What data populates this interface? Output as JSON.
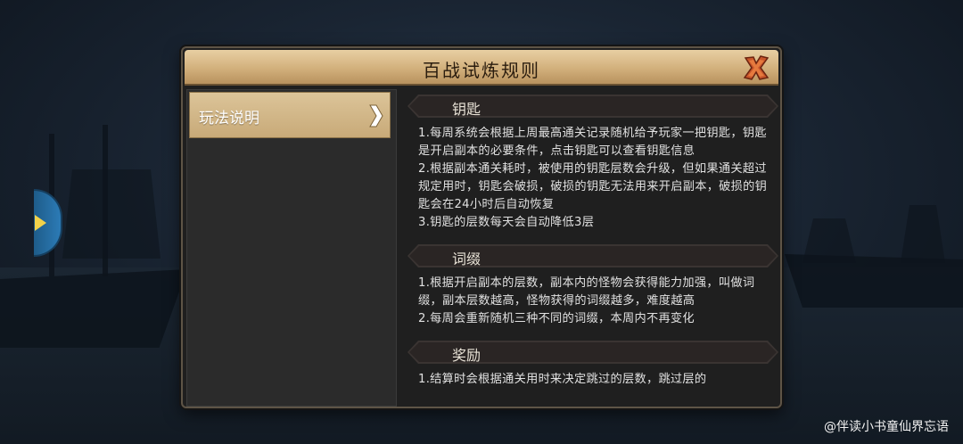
{
  "dialog": {
    "title": "百战试炼规则"
  },
  "menu": {
    "items": [
      {
        "label": "玩法说明"
      }
    ]
  },
  "sections": [
    {
      "header": "钥匙",
      "lines": [
        "1.每周系统会根据上周最高通关记录随机给予玩家一把钥匙，钥匙是开启副本的必要条件，点击钥匙可以查看钥匙信息",
        "2.根据副本通关耗时，被使用的钥匙层数会升级，但如果通关超过规定用时，钥匙会破损，破损的钥匙无法用来开启副本，破损的钥匙会在24小时后自动恢复",
        "3.钥匙的层数每天会自动降低3层"
      ]
    },
    {
      "header": "词缀",
      "lines": [
        "1.根据开启副本的层数，副本内的怪物会获得能力加强，叫做词缀，副本层数越高，怪物获得的词缀越多，难度越高",
        "2.每周会重新随机三种不同的词缀，本周内不再变化"
      ]
    },
    {
      "header": "奖励",
      "lines": [
        "1.结算时会根据通关用时来决定跳过的层数，跳过层的"
      ]
    }
  ],
  "watermark": "@伴读小书童仙界忘语",
  "colors": {
    "title_bar": "#d2b07c",
    "panel_bg": "#1f1f1f",
    "menu_selected": "#c8aa78",
    "side_tab": "#2c7bb6",
    "side_tab_arrow": "#f2d24a",
    "close_x": "#c8552a"
  },
  "icons": {
    "close": "close-x-icon",
    "menu_chevron": "chevron-right-icon",
    "side_tab": "expand-arrow-icon"
  }
}
